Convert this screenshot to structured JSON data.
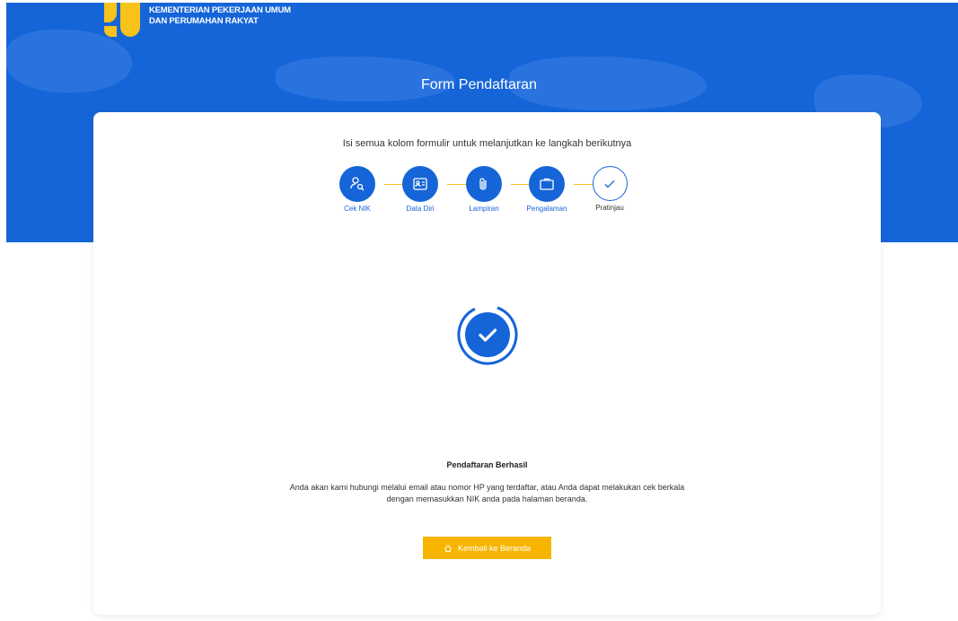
{
  "header": {
    "org_line1": "KEMENTERIAN PEKERJAAN UMUM",
    "org_line2": "DAN PERUMAHAN RAKYAT",
    "page_title": "Form Pendaftaran"
  },
  "form": {
    "instruction": "Isi semua kolom formulir untuk melanjutkan ke langkah berikutnya",
    "steps": [
      {
        "label": "Cek NIK",
        "icon": "user-search-icon",
        "status": "done"
      },
      {
        "label": "Data Diri",
        "icon": "id-card-icon",
        "status": "done"
      },
      {
        "label": "Lampiran",
        "icon": "paperclip-icon",
        "status": "done"
      },
      {
        "label": "Pengalaman",
        "icon": "briefcase-icon",
        "status": "done"
      },
      {
        "label": "Pratinjau",
        "icon": "check-icon",
        "status": "pending"
      }
    ]
  },
  "success": {
    "title": "Pendaftaran Berhasil",
    "line1": "Anda akan kami hubungi melalui email atau nomor HP yang terdaftar, atau Anda dapat melakukan cek berkala",
    "line2": "dengan memasukkan NIK anda pada halaman beranda.",
    "button_label": "Kembali ke Beranda",
    "button_icon": "home-icon"
  },
  "colors": {
    "primary": "#1565d8",
    "accent": "#f7b500"
  }
}
